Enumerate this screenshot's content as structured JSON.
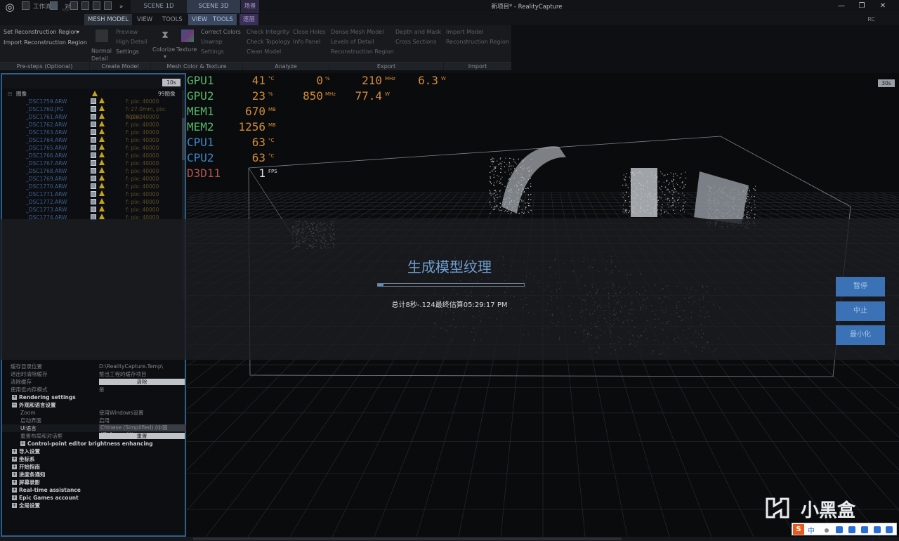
{
  "window": {
    "title": "新项目* - RealityCapture",
    "rc_label": "RC",
    "quick_tabs": [
      "工作流程",
      "对齐"
    ],
    "scene_tabs": {
      "s1d": "SCENE 1D",
      "s3d": "SCENE 3D",
      "views": "场景"
    }
  },
  "ribbon": {
    "tabs": {
      "mesh": "MESH MODEL",
      "view": "VIEW",
      "tools": "TOOLS",
      "view2": "VIEW",
      "tools2": "TOOLS",
      "views": "逐层"
    },
    "prestep": {
      "set_region": "Set Reconstruction Region",
      "import_region": "Import Reconstruction Region"
    },
    "create": {
      "preview": "Preview",
      "high": "High Detail",
      "normal": "Normal Detail",
      "settings": "Settings"
    },
    "color": {
      "colorize": "Colorize",
      "texture": "Texture",
      "correct": "Correct Colors",
      "unwrap": "Unwrap",
      "settings": "Settings"
    },
    "analyze": {
      "integrity": "Check Integrity",
      "close_holes": "Close Holes",
      "topology": "Check Topology",
      "info": "Info Panel",
      "clean": "Clean Model"
    },
    "export": {
      "dense": "Dense Mesh Model",
      "lod": "Levels of Detail",
      "recon_region": "Reconstruction Region",
      "depth": "Depth and Mask",
      "sections": "Cross Sections"
    },
    "import": {
      "model": "Import Model",
      "region": "Reconstruction Region"
    },
    "groups": {
      "pre": "Pre-steps (Optional)",
      "create": "Create Model",
      "color": "Mesh Color & Texture",
      "analyze": "Analyze",
      "export": "Export",
      "import": "Import"
    }
  },
  "left_panel": {
    "badge": "10s",
    "tree_title": "图像",
    "tree_count": "99图像",
    "images": [
      {
        "name": "_DSC1759.ARW",
        "info": "f: pix: 40000"
      },
      {
        "name": "_DSC1760.JPG",
        "info": "f: 27.0mm, pix: 40000"
      },
      {
        "name": "_DSC1761.ARW",
        "info": "f: pix: 40000"
      },
      {
        "name": "_DSC1762.ARW",
        "info": "f: pix: 40000"
      },
      {
        "name": "_DSC1763.ARW",
        "info": "f: pix: 40000"
      },
      {
        "name": "_DSC1764.ARW",
        "info": "f: pix: 40000"
      },
      {
        "name": "_DSC1765.ARW",
        "info": "f: pix: 40000"
      },
      {
        "name": "_DSC1766.ARW",
        "info": "f: pix: 40000"
      },
      {
        "name": "_DSC1767.ARW",
        "info": "f: pix: 40000"
      },
      {
        "name": "_DSC1768.ARW",
        "info": "f: pix: 40000"
      },
      {
        "name": "_DSC1769.ARW",
        "info": "f: pix: 40000"
      },
      {
        "name": "_DSC1770.ARW",
        "info": "f: pix: 40000"
      },
      {
        "name": "_DSC1771.ARW",
        "info": "f: pix: 40000"
      },
      {
        "name": "_DSC1772.ARW",
        "info": "f: pix: 40000"
      },
      {
        "name": "_DSC1773.ARW",
        "info": "f: pix: 40000"
      },
      {
        "name": "_DSC1774.ARW",
        "info": "f: pix: 40000"
      }
    ],
    "settings": {
      "cache_label": "缓存目录位置",
      "cache_value": "D:\\RealityCapture.Temp\\",
      "clear_label": "退出时清除缓存",
      "clear_value": "整出工程的缓存项目",
      "clear_cache_label": "清除缓存",
      "clear_cache_btn": "清除",
      "high_mem_label": "使用低内存模式",
      "high_mem_value": "是",
      "rendering": "Rendering settings",
      "appearance": "外观和语言设置",
      "zoom_label": "Zoom",
      "zoom_value": "使用Windows设置",
      "theme_label": "启动界面",
      "theme_value": "启用",
      "ui_lang_label": "UI语言",
      "ui_lang_value": "Chinese (Simplified) (中国 (Zhōngguó))",
      "reset_label": "重置布局和对话框",
      "reset_btn": "重置",
      "cp_brightness": "Control-point editor brightness enhancing",
      "g1": "导入设置",
      "g2": "坐标系",
      "g3": "开始指南",
      "g4": "进度条通知",
      "g5": "屏幕录影",
      "g6": "Real-time assistance",
      "g7": "Epic Games account",
      "g8": "全局设置"
    }
  },
  "hud": {
    "gpu1_label": "GPU1",
    "gpu1_temp": "41",
    "gpu1_temp_unit": "°C",
    "gpu1_load": "0",
    "gpu1_load_unit": "%",
    "gpu1_clock": "210",
    "gpu1_clock_unit": "MHz",
    "gpu1_power": "6.3",
    "gpu1_power_unit": "W",
    "gpu2_label": "GPU2",
    "gpu2_temp": "23",
    "gpu2_temp_unit": "%",
    "gpu2_clock": "850",
    "gpu2_clock_unit": "MHz",
    "gpu2_power": "77.4",
    "gpu2_power_unit": "W",
    "mem1_label": "MEM1",
    "mem1_val": "670",
    "mem1_unit": "MB",
    "mem2_label": "MEM2",
    "mem2_val": "1256",
    "mem2_unit": "MB",
    "cpu1_label": "CPU1",
    "cpu1_val": "63",
    "cpu1_unit": "°C",
    "cpu2_label": "CPU2",
    "cpu2_val": "63",
    "cpu2_unit": "°C",
    "d3d_label": "D3D11",
    "fps_val": "1",
    "fps_unit": "FPS",
    "viewport_badge": "30s"
  },
  "progress": {
    "title": "生成模型纹理",
    "fraction": 0.04,
    "status": "总计8秒-.124最终估算05:29:17 PM",
    "pause": "暂停",
    "stop": "中止",
    "minimize": "最小化"
  },
  "watermark": {
    "text": "小黑盒"
  },
  "ime": {
    "brand": "S",
    "mode": "中"
  }
}
